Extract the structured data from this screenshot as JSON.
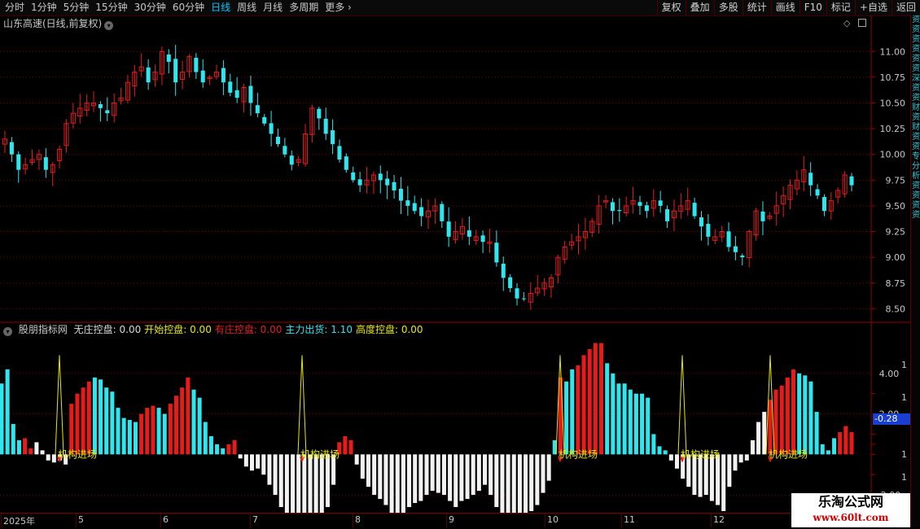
{
  "toolbar": {
    "period_tabs": [
      "分时",
      "1分钟",
      "5分钟",
      "15分钟",
      "30分钟",
      "60分钟",
      "日线",
      "周线",
      "月线",
      "多周期",
      "更多"
    ],
    "active_tab": "日线",
    "right_buttons": [
      "复权",
      "叠加",
      "多股",
      "统计",
      "画线",
      "F10",
      "标记",
      "+自选",
      "返回"
    ]
  },
  "stock": {
    "title": "山东高速(日线,前复权)"
  },
  "right_panel_text": "资资资资资资深资资财资财资资专分析资资资资",
  "indicator": {
    "name": "股朋指标网",
    "readouts": [
      {
        "label": "无庄控盘:",
        "value": "0.00",
        "color": "#d8d8d8"
      },
      {
        "label": "开始控盘:",
        "value": "0.00",
        "color": "#e8e800"
      },
      {
        "label": "有庄控盘:",
        "value": "0.00",
        "color": "#e02020"
      },
      {
        "label": "主力出货:",
        "value": "1.10",
        "color": "#2ee6ee"
      },
      {
        "label": "高度控盘:",
        "value": "0.00",
        "color": "#e8e800"
      }
    ],
    "current_value": "-0.28",
    "signal_label": "机构进场"
  },
  "price_axis": [
    "11.00",
    "10.75",
    "10.50",
    "10.25",
    "10.00",
    "9.75",
    "9.50",
    "9.25",
    "9.00",
    "8.75",
    "8.50"
  ],
  "ind_axis": [
    "4.00",
    "2.00",
    "-2.00"
  ],
  "ind_axis_side": [
    "1",
    "1",
    "1",
    "1",
    "1",
    "1",
    "1",
    "1"
  ],
  "date_axis": [
    "2025年",
    "5",
    "6",
    "7",
    "8",
    "9",
    "10",
    "11",
    "12"
  ],
  "watermark": {
    "line1": "乐淘公式网",
    "line2": "www.60lt.com"
  },
  "chart_data": {
    "type": "candlestick",
    "title": "山东高速(日线,前复权)",
    "ylim": [
      8.4,
      11.2
    ],
    "up_color": "#e81b1b",
    "down_color": "#2ee6ee",
    "closes": [
      10.15,
      10.0,
      9.85,
      9.9,
      9.95,
      10.0,
      9.85,
      9.9,
      10.05,
      10.3,
      10.4,
      10.45,
      10.5,
      10.5,
      10.45,
      10.4,
      10.5,
      10.55,
      10.7,
      10.8,
      10.85,
      10.7,
      10.8,
      11.0,
      10.9,
      10.7,
      10.8,
      10.95,
      10.8,
      10.7,
      10.75,
      10.8,
      10.7,
      10.6,
      10.55,
      10.65,
      10.5,
      10.4,
      10.3,
      10.2,
      10.1,
      10.0,
      9.9,
      9.95,
      10.2,
      10.45,
      10.35,
      10.2,
      10.1,
      9.95,
      9.85,
      9.75,
      9.7,
      9.75,
      9.8,
      9.75,
      9.7,
      9.65,
      9.55,
      9.5,
      9.45,
      9.4,
      9.45,
      9.5,
      9.35,
      9.2,
      9.25,
      9.3,
      9.2,
      9.2,
      9.15,
      9.15,
      8.95,
      8.8,
      8.7,
      8.6,
      8.6,
      8.65,
      8.7,
      8.75,
      8.8,
      9.0,
      9.1,
      9.15,
      9.2,
      9.25,
      9.35,
      9.5,
      9.55,
      9.45,
      9.45,
      9.5,
      9.55,
      9.5,
      9.45,
      9.55,
      9.5,
      9.35,
      9.45,
      9.5,
      9.55,
      9.4,
      9.3,
      9.2,
      9.2,
      9.25,
      9.1,
      9.05,
      9.0,
      9.25,
      9.45,
      9.35,
      9.4,
      9.5,
      9.6,
      9.7,
      9.75,
      9.85,
      9.7,
      9.6,
      9.45,
      9.55,
      9.65,
      9.8,
      9.7
    ]
  },
  "indicator_data": {
    "type": "bar",
    "ylim": [
      -2.8,
      5.8
    ],
    "bars": [
      3.5,
      4.2,
      1.5,
      0.7,
      0.8,
      0.3,
      0.6,
      0.2,
      -0.3,
      -0.4,
      -0.3,
      -0.5,
      2.5,
      3.0,
      3.3,
      3.6,
      3.8,
      3.7,
      3.3,
      3.1,
      2.3,
      1.8,
      1.7,
      1.6,
      2.0,
      2.3,
      2.4,
      2.3,
      2.0,
      2.5,
      2.9,
      3.3,
      3.8,
      3.2,
      2.8,
      1.6,
      0.9,
      0.5,
      0.3,
      0.5,
      0.7,
      -0.2,
      -0.6,
      -0.8,
      -0.7,
      -1.0,
      -1.5,
      -2.0,
      -2.6,
      -3.0,
      -3.4,
      -3.5,
      -3.7,
      -3.5,
      -3.6,
      -3.2,
      -2.6,
      -1.5,
      0.6,
      0.9,
      0.7,
      -0.5,
      -1.2,
      -1.6,
      -2.0,
      -2.2,
      -2.5,
      -3.0,
      -3.3,
      -3.0,
      -2.6,
      -2.4,
      -2.3,
      -2.0,
      -1.8,
      -1.9,
      -2.0,
      -2.3,
      -2.6,
      -2.3,
      -2.2,
      -2.0,
      -1.8,
      -1.5,
      -2.0,
      -2.6,
      -3.0,
      -3.5,
      -3.7,
      -3.7,
      -3.3,
      -2.8,
      -2.5,
      -1.9,
      -1.3,
      0.7,
      3.8,
      3.6,
      4.2,
      4.4,
      4.9,
      5.2,
      5.5,
      5.5,
      4.5,
      4.0,
      3.5,
      3.5,
      3.2,
      3.0,
      3.0,
      2.8,
      1.0,
      0.4,
      0.2,
      -0.3,
      -0.7,
      -1.2,
      -1.6,
      -2.0,
      -2.1,
      -2.0,
      -2.3,
      -2.5,
      -2.8,
      -1.6,
      -0.8,
      -0.4,
      -0.3,
      0.7,
      1.6,
      2.1,
      2.7,
      3.2,
      3.4,
      3.8,
      4.2,
      4.0,
      3.9,
      3.6,
      2.1,
      0.5,
      0.2,
      0.8,
      1.1,
      1.4,
      1.1
    ],
    "colors": [
      "c",
      "c",
      "c",
      "c",
      "r",
      "r",
      "w",
      "w",
      "w",
      "w",
      "w",
      "w",
      "r",
      "r",
      "r",
      "r",
      "c",
      "c",
      "c",
      "c",
      "c",
      "c",
      "c",
      "c",
      "r",
      "r",
      "r",
      "c",
      "c",
      "r",
      "r",
      "r",
      "r",
      "c",
      "c",
      "c",
      "c",
      "c",
      "c",
      "r",
      "r",
      "w",
      "w",
      "w",
      "w",
      "w",
      "w",
      "w",
      "w",
      "w",
      "w",
      "w",
      "w",
      "w",
      "w",
      "w",
      "w",
      "w",
      "r",
      "r",
      "r",
      "w",
      "w",
      "w",
      "w",
      "w",
      "w",
      "w",
      "w",
      "w",
      "w",
      "w",
      "w",
      "w",
      "w",
      "w",
      "w",
      "w",
      "w",
      "w",
      "w",
      "w",
      "w",
      "w",
      "w",
      "w",
      "w",
      "w",
      "w",
      "w",
      "w",
      "w",
      "w",
      "w",
      "w",
      "c",
      "r",
      "c",
      "c",
      "r",
      "r",
      "r",
      "r",
      "r",
      "c",
      "c",
      "c",
      "c",
      "c",
      "c",
      "c",
      "c",
      "c",
      "c",
      "c",
      "w",
      "w",
      "w",
      "w",
      "w",
      "w",
      "w",
      "w",
      "w",
      "w",
      "w",
      "w",
      "w",
      "w",
      "w",
      "w",
      "w",
      "r",
      "r",
      "r",
      "r",
      "r",
      "c",
      "c",
      "c",
      "c",
      "c",
      "c",
      "c",
      "r",
      "r",
      "r",
      "c"
    ],
    "signal_positions": [
      14,
      95,
      125
    ]
  }
}
